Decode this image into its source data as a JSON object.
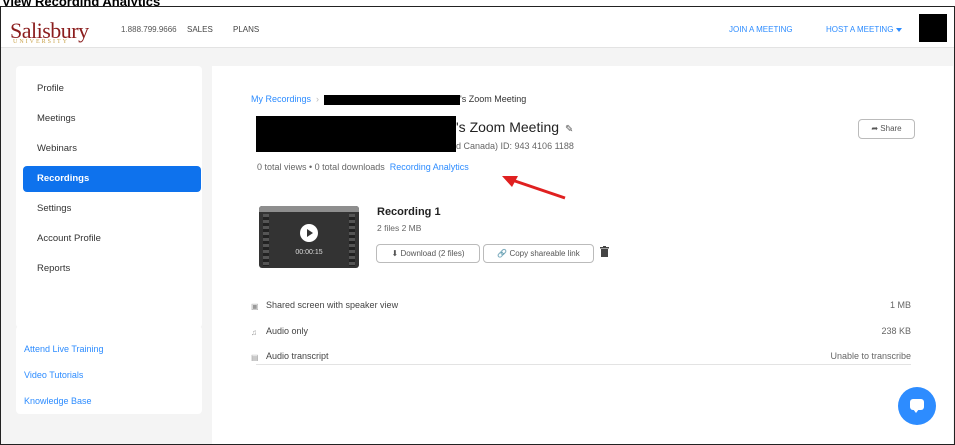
{
  "caption": "View Recording Analytics",
  "header": {
    "logo_text": "Salisbury",
    "logo_subtext": "UNIVERSITY",
    "phone": "1.888.799.9666",
    "nav_sales": "SALES",
    "nav_plans": "PLANS",
    "join_meeting": "JOIN A MEETING",
    "host_meeting": "HOST A MEETING"
  },
  "sidebar": {
    "items": [
      {
        "label": "Profile"
      },
      {
        "label": "Meetings"
      },
      {
        "label": "Webinars"
      },
      {
        "label": "Recordings",
        "active": true
      },
      {
        "label": "Settings"
      },
      {
        "label": "Account Profile"
      },
      {
        "label": "Reports"
      }
    ],
    "links": [
      {
        "label": "Attend Live Training"
      },
      {
        "label": "Video Tutorials"
      },
      {
        "label": "Knowledge Base"
      }
    ]
  },
  "breadcrumb": {
    "root": "My Recordings",
    "current_suffix": "'s Zoom Meeting"
  },
  "meeting": {
    "title_suffix": "'s Zoom Meeting",
    "meta": "d Canada)   ID: 943 4106 1188",
    "share_label": "Share",
    "stats": "0 total views • 0 total downloads",
    "analytics_link": "Recording Analytics"
  },
  "recording": {
    "title": "Recording 1",
    "subtitle": "2 files  2 MB",
    "duration": "00:00:15",
    "download_label": "Download (2 files)",
    "copy_link_label": "Copy shareable link"
  },
  "files": [
    {
      "icon": "screen-icon",
      "name": "Shared screen with speaker view",
      "size": "1 MB"
    },
    {
      "icon": "audio-icon",
      "name": "Audio only",
      "size": "238 KB"
    },
    {
      "icon": "transcript-icon",
      "name": "Audio transcript",
      "size": "Unable to transcribe"
    }
  ],
  "colors": {
    "brand": "#8b1d1d",
    "accent": "#2d8cff",
    "active": "#0e72ed",
    "annotation_arrow": "#e02020"
  }
}
